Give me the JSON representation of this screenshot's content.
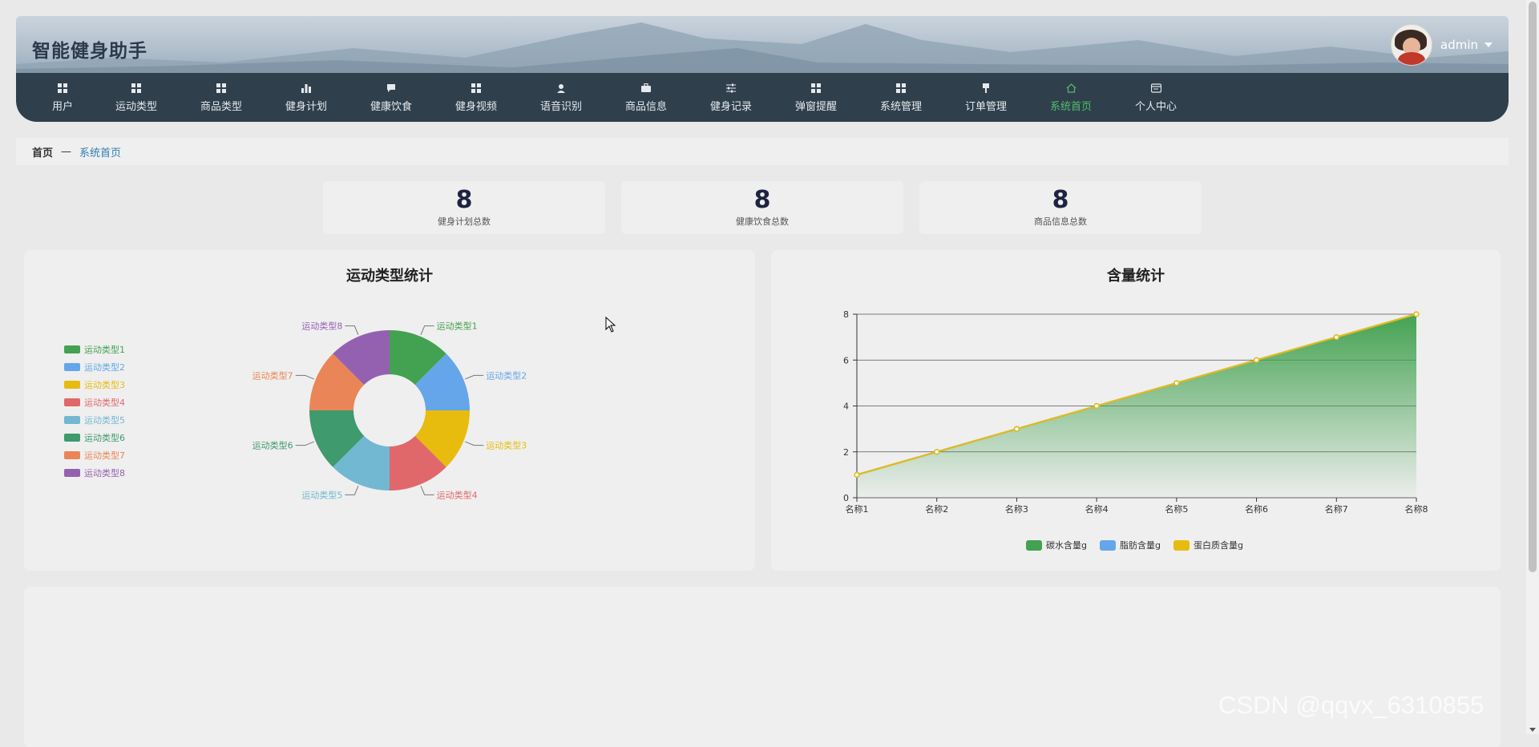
{
  "app": {
    "title": "智能健身助手",
    "user": "admin"
  },
  "nav": {
    "items": [
      {
        "label": "用户",
        "icon": "grid-icon"
      },
      {
        "label": "运动类型",
        "icon": "grid-icon"
      },
      {
        "label": "商品类型",
        "icon": "grid-icon"
      },
      {
        "label": "健身计划",
        "icon": "bar-chart-icon"
      },
      {
        "label": "健康饮食",
        "icon": "chat-icon"
      },
      {
        "label": "健身视频",
        "icon": "grid-icon"
      },
      {
        "label": "语音识别",
        "icon": "user-icon"
      },
      {
        "label": "商品信息",
        "icon": "briefcase-icon"
      },
      {
        "label": "健身记录",
        "icon": "sliders-icon"
      },
      {
        "label": "弹窗提醒",
        "icon": "grid-icon"
      },
      {
        "label": "系统管理",
        "icon": "grid-icon"
      },
      {
        "label": "订单管理",
        "icon": "flag-icon"
      },
      {
        "label": "系统首页",
        "icon": "home-icon",
        "active": true
      },
      {
        "label": "个人中心",
        "icon": "id-card-icon"
      }
    ],
    "active_color": "#4fbf6a"
  },
  "breadcrumb": {
    "home": "首页",
    "separator": "—",
    "current": "系统首页"
  },
  "stats": [
    {
      "value": "8",
      "label": "健身计划总数"
    },
    {
      "value": "8",
      "label": "健康饮食总数"
    },
    {
      "value": "8",
      "label": "商品信息总数"
    }
  ],
  "panels": {
    "pie_title": "运动类型统计",
    "line_title": "含量统计"
  },
  "chart_data": [
    {
      "type": "pie",
      "title": "运动类型统计",
      "donut": true,
      "legend_placement": "left",
      "categories": [
        "运动类型1",
        "运动类型2",
        "运动类型3",
        "运动类型4",
        "运动类型5",
        "运动类型6",
        "运动类型7",
        "运动类型8"
      ],
      "values": [
        1,
        1,
        1,
        1,
        1,
        1,
        1,
        1
      ],
      "colors": [
        "#43a251",
        "#64a6e9",
        "#e8bc0f",
        "#e0686a",
        "#73b8d2",
        "#3f9a6e",
        "#ea8557",
        "#9461b0"
      ]
    },
    {
      "type": "area",
      "title": "含量统计",
      "categories": [
        "名称1",
        "名称2",
        "名称3",
        "名称4",
        "名称5",
        "名称6",
        "名称7",
        "名称8"
      ],
      "ylim": [
        0,
        8
      ],
      "yticks": [
        0,
        2,
        4,
        6,
        8
      ],
      "grid": true,
      "legend_placement": "bottom",
      "series": [
        {
          "name": "碳水含量g",
          "values": [
            1,
            2,
            3,
            4,
            5,
            6,
            7,
            8
          ],
          "color": "#43a251"
        },
        {
          "name": "脂肪含量g",
          "values": [
            1,
            2,
            3,
            4,
            5,
            6,
            7,
            8
          ],
          "color": "#64a6e9"
        },
        {
          "name": "蛋白质含量g",
          "values": [
            1,
            2,
            3,
            4,
            5,
            6,
            7,
            8
          ],
          "color": "#e8bc0f"
        }
      ]
    }
  ],
  "watermark": "CSDN @qqvx_6310855"
}
